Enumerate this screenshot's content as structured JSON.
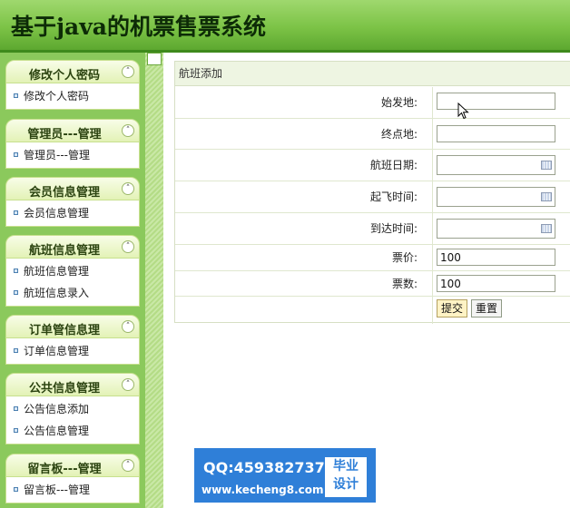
{
  "header": {
    "title": "基于java的机票售票系统"
  },
  "sidebar": {
    "groups": [
      {
        "title": "修改个人密码",
        "items": [
          "修改个人密码"
        ]
      },
      {
        "title": "管理员---管理",
        "items": [
          "管理员---管理"
        ]
      },
      {
        "title": "会员信息管理",
        "items": [
          "会员信息管理"
        ]
      },
      {
        "title": "航班信息管理",
        "items": [
          "航班信息管理",
          "航班信息录入"
        ]
      },
      {
        "title": "订单管信息理",
        "items": [
          "订单信息管理"
        ]
      },
      {
        "title": "公共信息管理",
        "items": [
          "公告信息添加",
          "公告信息管理"
        ]
      },
      {
        "title": "留言板---管理",
        "items": [
          "留言板---管理"
        ]
      }
    ],
    "toggle_glyph": "˄"
  },
  "form": {
    "title": "航班添加",
    "fields": [
      {
        "label": "始发地:",
        "value": "",
        "type": "text"
      },
      {
        "label": "终点地:",
        "value": "",
        "type": "text"
      },
      {
        "label": "航班日期:",
        "value": "",
        "type": "date"
      },
      {
        "label": "起飞时间:",
        "value": "",
        "type": "date"
      },
      {
        "label": "到达时间:",
        "value": "",
        "type": "date"
      },
      {
        "label": "票价:",
        "value": "100",
        "type": "text"
      },
      {
        "label": "票数:",
        "value": "100",
        "type": "text"
      }
    ],
    "submit_label": "提交",
    "reset_label": "重置"
  },
  "watermark": {
    "qq": "QQ:459382737",
    "site": "www.kecheng8.com",
    "badge_line1": "毕业",
    "badge_line2": "设计"
  },
  "colors": {
    "header_green": "#7cc346",
    "sidebar_green": "#8bc95c",
    "watermark_blue": "#2f7fd8"
  }
}
